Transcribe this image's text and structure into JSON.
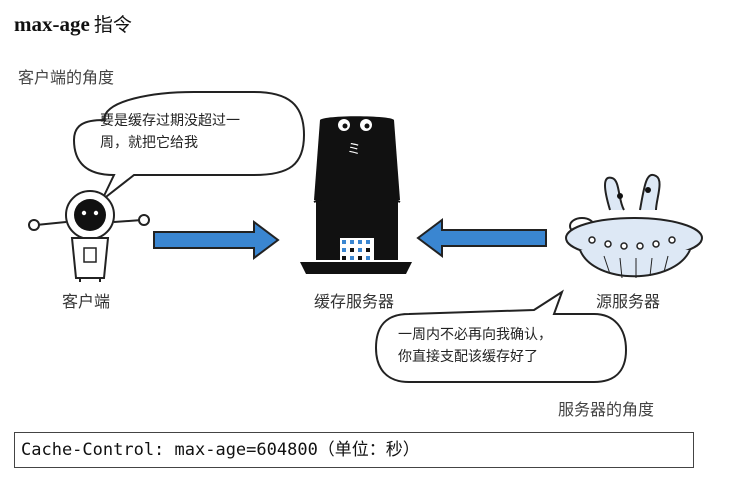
{
  "heading": {
    "keyword": "max-age",
    "suffix": "指令"
  },
  "diagram": {
    "client_view_caption": "客户端的角度",
    "server_view_caption": "服务器的角度",
    "client_label": "客户端",
    "cache_label": "缓存服务器",
    "origin_label": "源服务器",
    "client_bubble": {
      "line1": "要是缓存过期没超过一",
      "line2": "周，就把它给我"
    },
    "server_bubble": {
      "line1": "一周内不必再向我确认，",
      "line2": "你直接支配该缓存好了"
    },
    "arrow_color": "#3a86d1"
  },
  "code": "Cache-Control: max-age=604800（单位：秒）"
}
